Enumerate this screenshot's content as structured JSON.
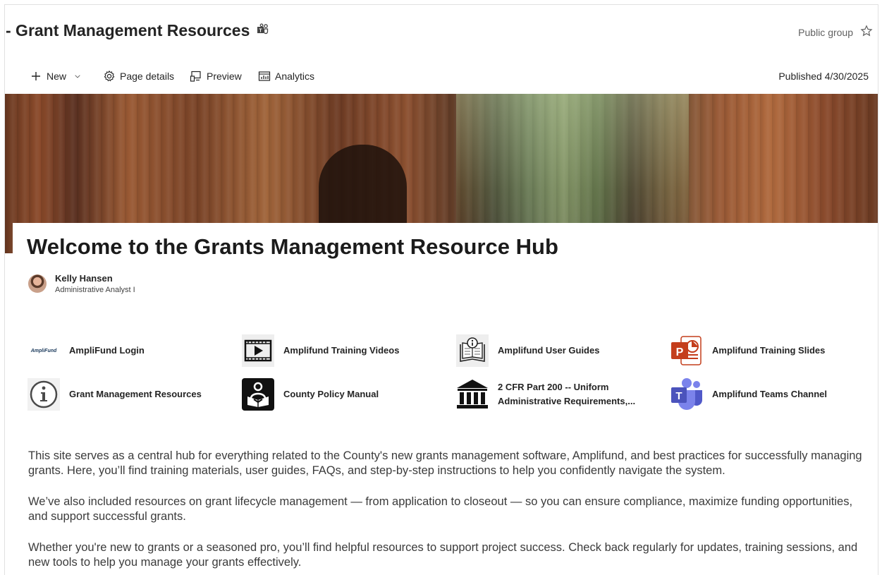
{
  "site": {
    "title": "- Grant Management Resources",
    "group_label": "Public group"
  },
  "command_bar": {
    "new_label": "New",
    "page_details_label": "Page details",
    "preview_label": "Preview",
    "analytics_label": "Analytics",
    "published": "Published 4/30/2025"
  },
  "page": {
    "title": "Welcome to the Grants Management Resource Hub",
    "author_name": "Kelly Hansen",
    "author_role": "Administrative Analyst I"
  },
  "quick_links": [
    {
      "label": "AmpliFund Login",
      "icon": "amplifund-logo",
      "logo_text": "AmpliFund"
    },
    {
      "label": "Amplifund Training Videos",
      "icon": "video-icon"
    },
    {
      "label": "Amplifund User Guides",
      "icon": "book-info-icon"
    },
    {
      "label": "Amplifund Training Slides",
      "icon": "powerpoint-icon"
    },
    {
      "label": "Grant Management Resources",
      "icon": "info-icon"
    },
    {
      "label": "County Policy Manual",
      "icon": "reader-icon"
    },
    {
      "label": "2 CFR Part 200 -- Uniform Administrative Requirements,...",
      "icon": "bank-icon"
    },
    {
      "label": "Amplifund Teams Channel",
      "icon": "teams-icon"
    }
  ],
  "body": {
    "p1": "This site serves as a central hub for everything related to the County's new grants management software, Amplifund, and best practices for successfully managing grants. Here, you’ll find training materials, user guides, FAQs, and step-by-step instructions to help you confidently navigate the system.",
    "p2": "We’ve also included resources on grant lifecycle management — from application to closeout — so you can ensure compliance, maximize funding opportunities, and support successful grants.",
    "p3": "Whether you're new to grants or a seasoned pro, you’ll find helpful resources to support project success. Check back regularly for updates, training sessions, and new tools to help you manage your grants effectively."
  },
  "colors": {
    "powerpoint": "#c43e1c",
    "teams": "#5059c9",
    "text": "#242424"
  }
}
